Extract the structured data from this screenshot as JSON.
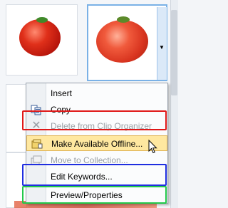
{
  "context_menu": {
    "items": [
      {
        "label": "Insert",
        "disabled": false
      },
      {
        "label": "Copy",
        "disabled": false
      },
      {
        "label": "Delete from Clip Organizer",
        "disabled": true
      },
      {
        "label": "Make Available Offline...",
        "disabled": false
      },
      {
        "label": "Move to Collection...",
        "disabled": true
      },
      {
        "label": "Edit Keywords...",
        "disabled": false
      },
      {
        "label": "Preview/Properties",
        "disabled": false
      }
    ]
  },
  "thumbnails": [
    {
      "subject": "tomato"
    },
    {
      "subject": "tomato",
      "selected": true
    }
  ],
  "dropdown_arrow": "▼",
  "icons": {
    "copy": "copy-icon",
    "delete": "delete-icon",
    "offline": "offline-icon",
    "move": "move-icon"
  },
  "highlight_colors": {
    "red": "#e01818",
    "blue": "#1f2ee0",
    "green": "#22c84a"
  }
}
